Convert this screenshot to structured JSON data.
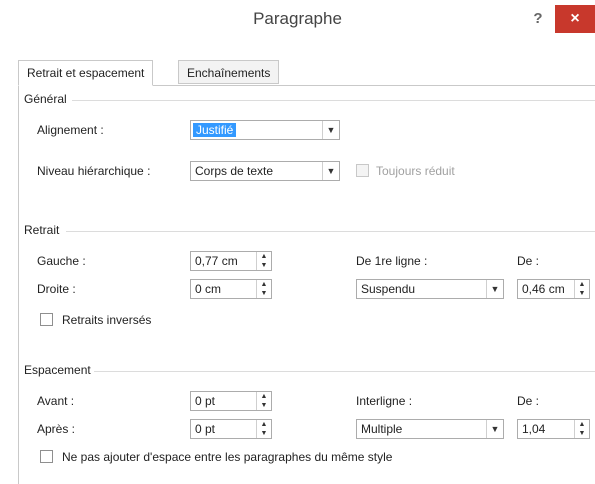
{
  "dialog": {
    "title": "Paragraphe",
    "help": "?",
    "close": "×"
  },
  "tabs": [
    {
      "label": "Retrait et espacement",
      "active": true
    },
    {
      "label": "Enchaînements",
      "active": false
    }
  ],
  "general": {
    "heading": "Général",
    "alignment_label": "Alignement :",
    "alignment_value": "Justifié",
    "level_label": "Niveau hiérarchique :",
    "level_value": "Corps de texte",
    "collapsed_label": "Toujours réduit"
  },
  "indent": {
    "heading": "Retrait",
    "left_label": "Gauche :",
    "left_value": "0,77 cm",
    "right_label": "Droite :",
    "right_value": "0 cm",
    "special_label": "De 1re ligne :",
    "special_value": "Suspendu",
    "by_label": "De :",
    "by_value": "0,46 cm",
    "mirror_label": "Retraits inversés"
  },
  "spacing": {
    "heading": "Espacement",
    "before_label": "Avant :",
    "before_value": "0 pt",
    "after_label": "Après :",
    "after_value": "0 pt",
    "line_label": "Interligne :",
    "line_value": "Multiple",
    "at_label": "De :",
    "at_value": "1,04",
    "no_space_label": "Ne pas ajouter d'espace entre les paragraphes du même style"
  },
  "icons": {
    "dropdown": "chevron-down-icon",
    "spinner": "spinner-arrows-icon",
    "close": "close-icon",
    "help": "help-icon"
  },
  "colors": {
    "close_button": "#c8382c",
    "selection": "#3399ff"
  }
}
